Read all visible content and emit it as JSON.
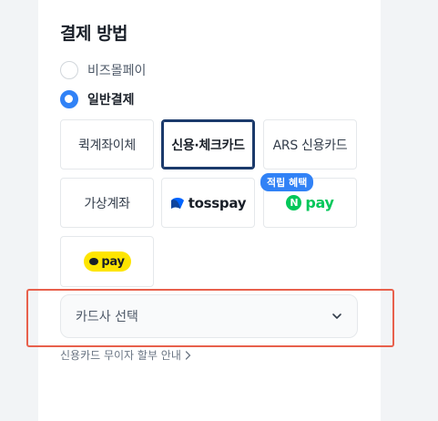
{
  "payment": {
    "title": "결제 방법",
    "options": [
      {
        "label": "비즈몰페이",
        "checked": false
      },
      {
        "label": "일반결제",
        "checked": true
      }
    ],
    "methods": {
      "quick_transfer": "퀵계좌이체",
      "credit_card": "신용·체크카드",
      "ars_card": "ARS 신용카드",
      "virtual_account": "가상계좌",
      "toss_pay": "tosspay",
      "naver_pay": "pay",
      "kakao_pay": "pay"
    },
    "badge": "적립 혜택",
    "card_select_placeholder": "카드사 선택",
    "installment_link": "신용카드 무이자 할부 안내"
  },
  "colors": {
    "accent": "#3182f6",
    "selected_border": "#1b3a6b",
    "highlight": "#e8604c",
    "naver": "#03c75a",
    "kakao": "#fee500"
  }
}
